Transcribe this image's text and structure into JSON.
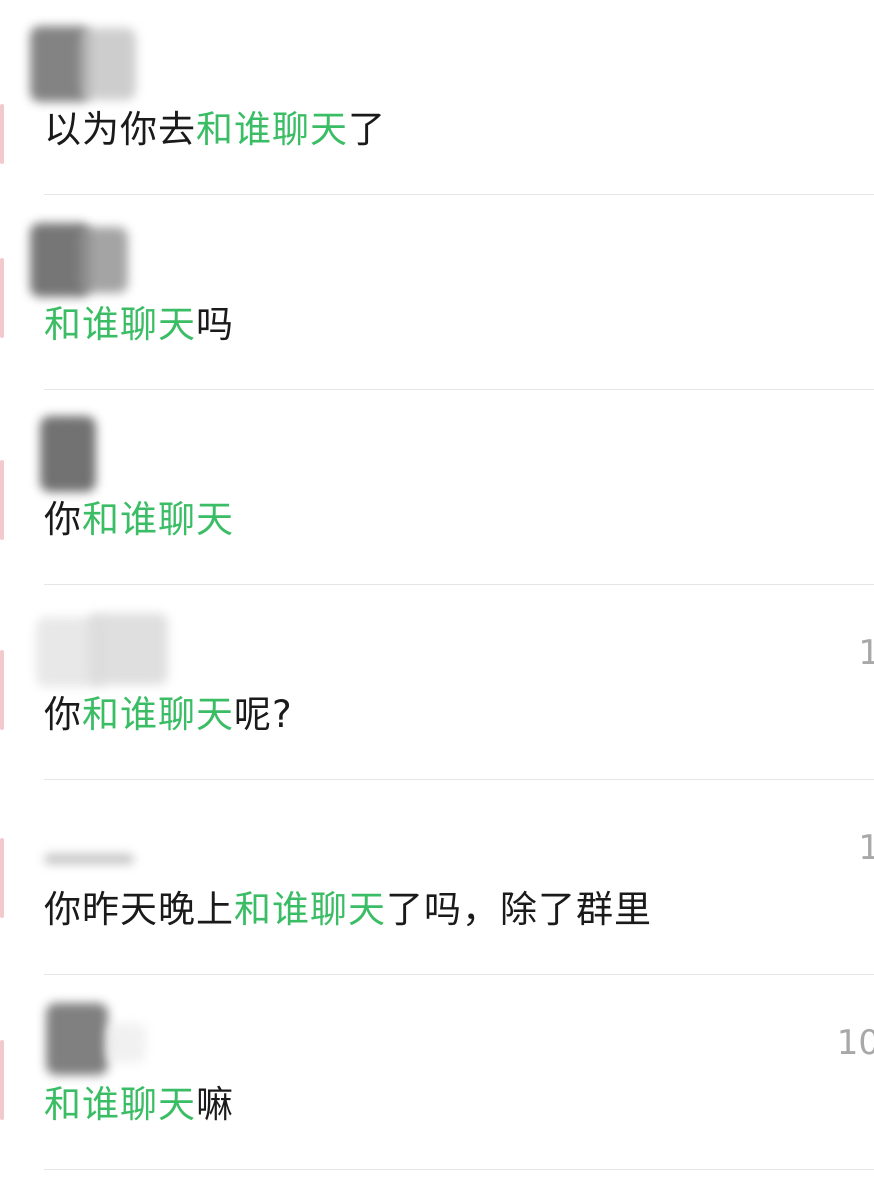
{
  "colors": {
    "highlight": "#3bbd65",
    "text": "#1a1a1a",
    "timestamp": "#a8a8a8",
    "divider": "#e6e6e6"
  },
  "results": [
    {
      "parts": [
        {
          "text": "以为你去",
          "hl": false
        },
        {
          "text": "和谁聊天",
          "hl": true
        },
        {
          "text": "了",
          "hl": false
        }
      ],
      "time": ""
    },
    {
      "parts": [
        {
          "text": "和谁聊天",
          "hl": true
        },
        {
          "text": "吗",
          "hl": false
        }
      ],
      "time": ""
    },
    {
      "parts": [
        {
          "text": "你",
          "hl": false
        },
        {
          "text": "和谁聊天",
          "hl": true
        }
      ],
      "time": ""
    },
    {
      "parts": [
        {
          "text": "你",
          "hl": false
        },
        {
          "text": "和谁聊天",
          "hl": true
        },
        {
          "text": "呢?",
          "hl": false
        }
      ],
      "time": "1"
    },
    {
      "parts": [
        {
          "text": "你昨天晚上",
          "hl": false
        },
        {
          "text": "和谁聊天",
          "hl": true
        },
        {
          "text": "了吗，除了群里",
          "hl": false
        }
      ],
      "time": "1"
    },
    {
      "parts": [
        {
          "text": "和谁聊天",
          "hl": true
        },
        {
          "text": "嘛",
          "hl": false
        }
      ],
      "time": "10"
    }
  ]
}
